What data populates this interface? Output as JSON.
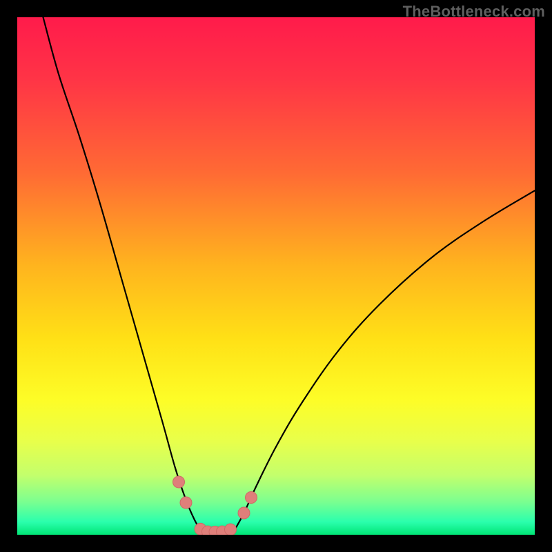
{
  "watermark": "TheBottleneck.com",
  "colors": {
    "black": "#000000",
    "curve_stroke": "#000000",
    "marker_fill": "#df7f7a",
    "marker_stroke": "#cf6a66",
    "watermark": "#5f5f5f"
  },
  "chart_data": {
    "type": "line",
    "title": "",
    "xlabel": "",
    "ylabel": "",
    "xlim": [
      0,
      100
    ],
    "ylim": [
      0,
      100
    ],
    "gradient_stops": [
      {
        "offset": 0.0,
        "color": "#ff1b4b"
      },
      {
        "offset": 0.12,
        "color": "#ff3446"
      },
      {
        "offset": 0.3,
        "color": "#ff6a34"
      },
      {
        "offset": 0.48,
        "color": "#ffb41e"
      },
      {
        "offset": 0.62,
        "color": "#ffe016"
      },
      {
        "offset": 0.74,
        "color": "#fdfd27"
      },
      {
        "offset": 0.82,
        "color": "#e8ff4b"
      },
      {
        "offset": 0.885,
        "color": "#c3ff6c"
      },
      {
        "offset": 0.935,
        "color": "#7dff8f"
      },
      {
        "offset": 0.975,
        "color": "#2bffad"
      },
      {
        "offset": 1.0,
        "color": "#00e676"
      }
    ],
    "series": [
      {
        "name": "left-curve",
        "x": [
          5,
          8,
          12,
          16,
          20,
          24,
          28,
          30.5,
          32.5,
          34.2,
          35.8
        ],
        "y": [
          100,
          89,
          77,
          64,
          50,
          36,
          22,
          13,
          7,
          3,
          0.2
        ]
      },
      {
        "name": "right-curve",
        "x": [
          41.6,
          43.8,
          46.0,
          50.0,
          55.0,
          62.0,
          70.0,
          80.0,
          90.0,
          100.0
        ],
        "y": [
          0.2,
          4.2,
          9.0,
          17.0,
          25.5,
          35.5,
          44.5,
          53.5,
          60.5,
          66.5
        ]
      }
    ],
    "markers": [
      {
        "x": 31.2,
        "y": 10.2
      },
      {
        "x": 32.6,
        "y": 6.2
      },
      {
        "x": 35.4,
        "y": 1.1
      },
      {
        "x": 36.8,
        "y": 0.6
      },
      {
        "x": 38.2,
        "y": 0.55
      },
      {
        "x": 39.6,
        "y": 0.6
      },
      {
        "x": 41.2,
        "y": 1.0
      },
      {
        "x": 43.8,
        "y": 4.2
      },
      {
        "x": 45.2,
        "y": 7.2
      }
    ]
  }
}
